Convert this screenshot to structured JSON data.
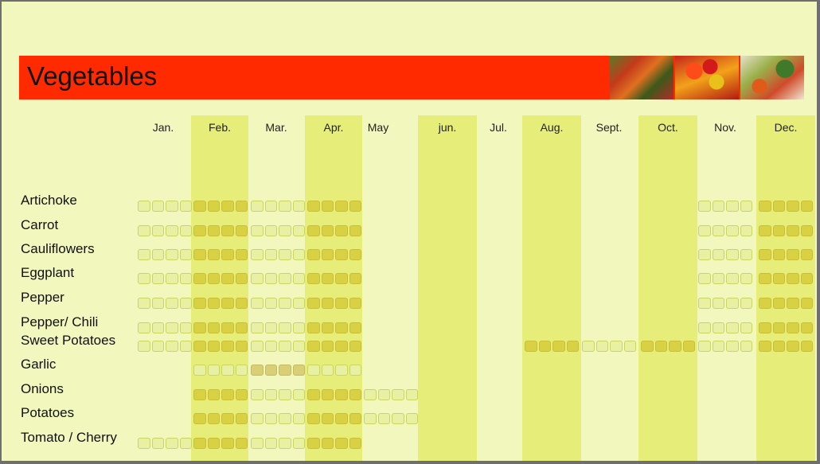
{
  "title": "Vegetables",
  "months": [
    "Jan.",
    "Feb.",
    "Mar.",
    "Apr.",
    "May",
    "jun.",
    "Jul.",
    "Aug.",
    "Sept.",
    "Oct.",
    "Nov.",
    "Dec."
  ],
  "vegetables": [
    {
      "name": "Artichoke",
      "months": [
        0,
        1,
        2,
        3,
        10,
        11
      ]
    },
    {
      "name": "Carrot",
      "months": [
        0,
        1,
        2,
        3,
        10,
        11
      ]
    },
    {
      "name": "Cauliflowers",
      "months": [
        0,
        1,
        2,
        3,
        10,
        11
      ]
    },
    {
      "name": "Eggplant",
      "months": [
        0,
        1,
        2,
        3,
        10,
        11
      ]
    },
    {
      "name": "Pepper",
      "months": [
        0,
        1,
        2,
        3,
        10,
        11
      ]
    },
    {
      "name": "Pepper/ Chili",
      "months": [
        0,
        1,
        2,
        3,
        10,
        11
      ]
    },
    {
      "name": "Sweet Potatoes",
      "months": [
        0,
        1,
        2,
        3,
        7,
        8,
        9,
        10,
        11
      ]
    },
    {
      "name": "Garlic",
      "months": [
        1,
        2,
        3
      ]
    },
    {
      "name": "Onions",
      "months": [
        1,
        2,
        3,
        4
      ]
    },
    {
      "name": "Potatoes",
      "months": [
        1,
        2,
        3,
        4
      ]
    },
    {
      "name": "Tomato / Cherry",
      "months": [
        0,
        1,
        2,
        3
      ]
    }
  ],
  "images": [
    "vegetable-market-photo",
    "tomatoes-photo",
    "mixed-vegetables-photo"
  ]
}
